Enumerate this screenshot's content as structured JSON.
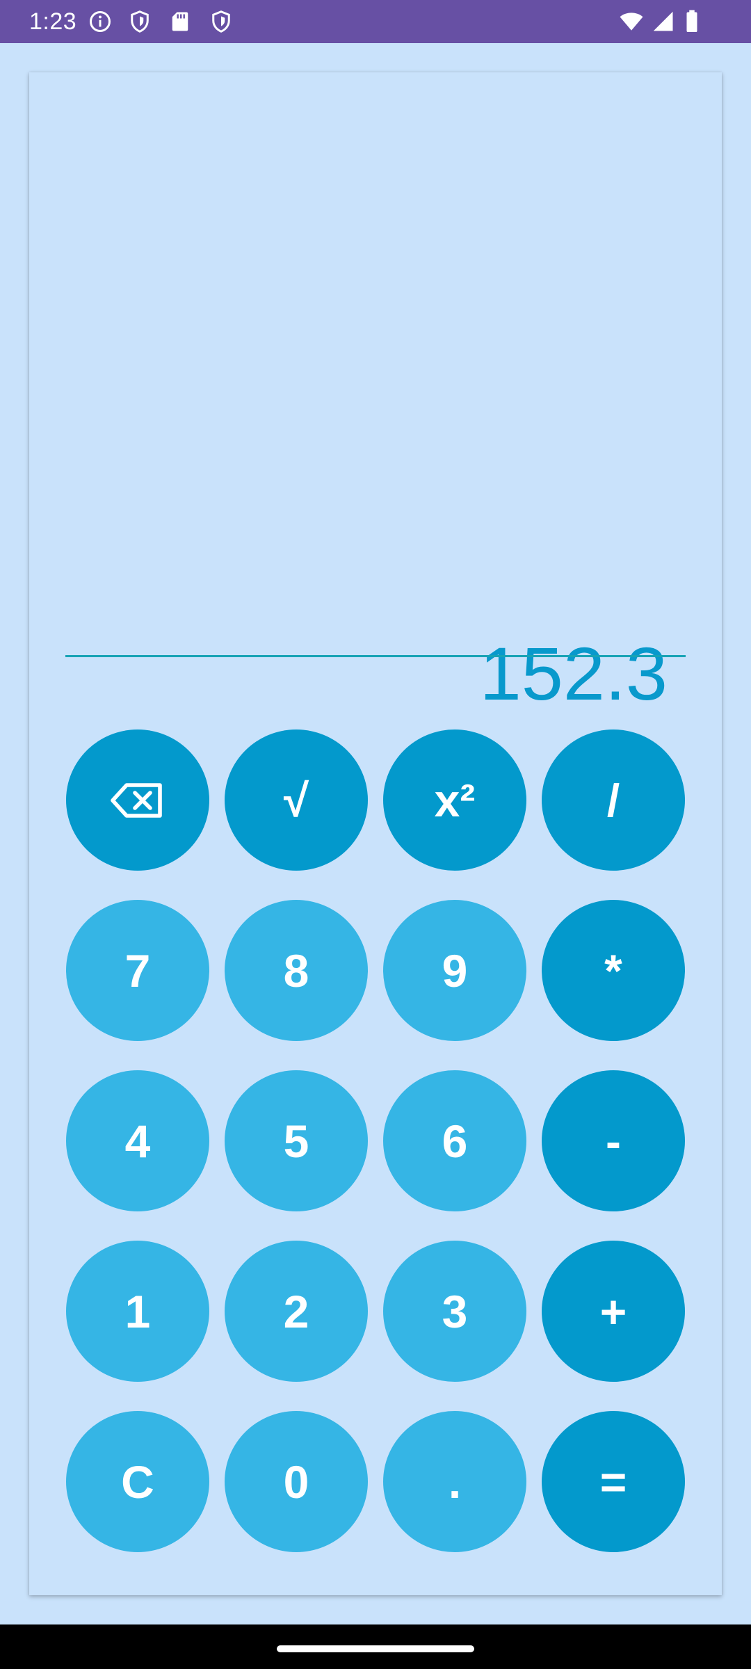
{
  "status_bar": {
    "time": "1:23",
    "left_icons": [
      "info-icon",
      "shield-icon",
      "sd-card-icon",
      "shield-icon"
    ],
    "right_icons": [
      "wifi-icon",
      "cellular-signal-icon",
      "battery-icon"
    ],
    "background_color": "#6750a4"
  },
  "display": {
    "value": "152.3",
    "color": "#0899cc"
  },
  "keypad": {
    "rows": [
      [
        {
          "name": "backspace-button",
          "label": "",
          "icon": "backspace-icon",
          "kind": "op"
        },
        {
          "name": "sqrt-button",
          "label": "√",
          "kind": "op"
        },
        {
          "name": "square-button",
          "label": "x²",
          "kind": "op"
        },
        {
          "name": "divide-button",
          "label": "/",
          "kind": "op"
        }
      ],
      [
        {
          "name": "digit-7-button",
          "label": "7",
          "kind": "num"
        },
        {
          "name": "digit-8-button",
          "label": "8",
          "kind": "num"
        },
        {
          "name": "digit-9-button",
          "label": "9",
          "kind": "num"
        },
        {
          "name": "multiply-button",
          "label": "*",
          "kind": "op"
        }
      ],
      [
        {
          "name": "digit-4-button",
          "label": "4",
          "kind": "num"
        },
        {
          "name": "digit-5-button",
          "label": "5",
          "kind": "num"
        },
        {
          "name": "digit-6-button",
          "label": "6",
          "kind": "num"
        },
        {
          "name": "subtract-button",
          "label": "-",
          "kind": "op"
        }
      ],
      [
        {
          "name": "digit-1-button",
          "label": "1",
          "kind": "num"
        },
        {
          "name": "digit-2-button",
          "label": "2",
          "kind": "num"
        },
        {
          "name": "digit-3-button",
          "label": "3",
          "kind": "num"
        },
        {
          "name": "add-button",
          "label": "+",
          "kind": "op"
        }
      ],
      [
        {
          "name": "clear-button",
          "label": "C",
          "kind": "num"
        },
        {
          "name": "digit-0-button",
          "label": "0",
          "kind": "num"
        },
        {
          "name": "decimal-button",
          "label": ".",
          "kind": "num"
        },
        {
          "name": "equals-button",
          "label": "=",
          "kind": "op"
        }
      ]
    ],
    "colors": {
      "operator": "#0399cc",
      "number": "#35b5e5",
      "text": "#ffffff"
    }
  },
  "theme": {
    "background": "#c9e2fb"
  }
}
